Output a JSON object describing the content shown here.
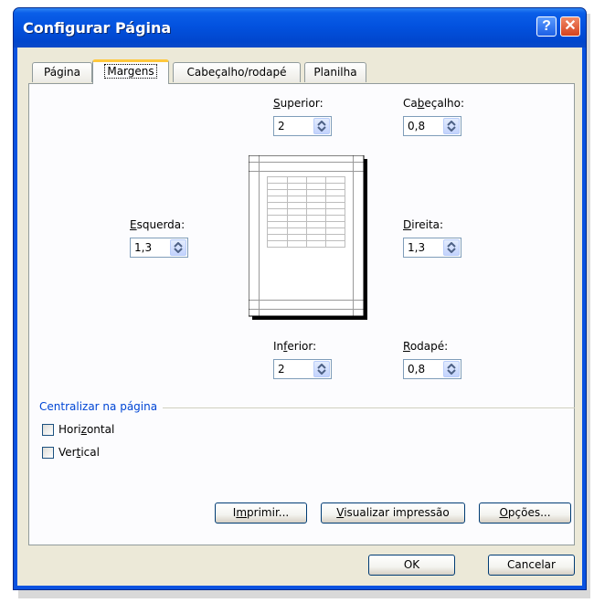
{
  "window": {
    "title": "Configurar Página",
    "help_symbol": "?",
    "close_symbol": "✕"
  },
  "tabs": [
    {
      "label": "Página",
      "active": false
    },
    {
      "label": "Margens",
      "active": true
    },
    {
      "label": "Cabeçalho/rodapé",
      "active": false
    },
    {
      "label": "Planilha",
      "active": false
    }
  ],
  "margins": {
    "top": {
      "label_pre": "",
      "label_key": "S",
      "label_post": "uperior:",
      "value": "2"
    },
    "header": {
      "label_pre": "Ca",
      "label_key": "b",
      "label_post": "eçalho:",
      "value": "0,8"
    },
    "left": {
      "label_pre": "",
      "label_key": "E",
      "label_post": "squerda:",
      "value": "1,3"
    },
    "right": {
      "label_pre": "",
      "label_key": "D",
      "label_post": "ireita:",
      "value": "1,3"
    },
    "bottom": {
      "label_pre": "In",
      "label_key": "f",
      "label_post": "erior:",
      "value": "2"
    },
    "footer": {
      "label_pre": "",
      "label_key": "R",
      "label_post": "odapé:",
      "value": "0,8"
    }
  },
  "center": {
    "title": "Centralizar na página",
    "horizontal": {
      "label_pre": "Hori",
      "label_key": "z",
      "label_post": "ontal",
      "checked": false
    },
    "vertical": {
      "label_pre": "Ver",
      "label_key": "t",
      "label_post": "ical",
      "checked": false
    }
  },
  "buttons": {
    "print": {
      "pre": "I",
      "key": "m",
      "post": "primir..."
    },
    "preview": {
      "pre": "",
      "key": "V",
      "post": "isualizar impressão"
    },
    "options": {
      "pre": "",
      "key": "O",
      "post": "pções..."
    },
    "ok": "OK",
    "cancel": "Cancelar"
  },
  "colors": {
    "titlebar": "#0352df",
    "group_title": "#0046d5",
    "active_tab_accent": "#ffc83c"
  }
}
